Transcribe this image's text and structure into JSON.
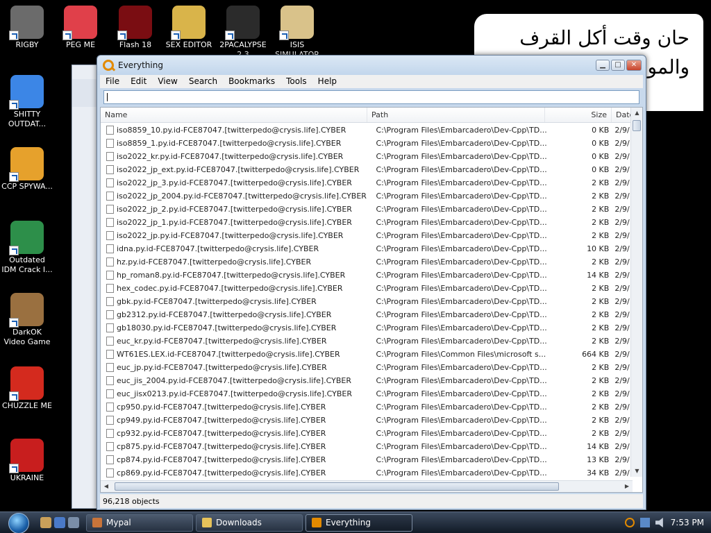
{
  "desktop_icons": [
    {
      "label": "RIGBY",
      "color": "#6b6b6b"
    },
    {
      "label": "PEG ME",
      "color": "#e0404a"
    },
    {
      "label": "Flash 18",
      "color": "#7a0d12"
    },
    {
      "label": "SEX EDITOR",
      "color": "#d9b44a"
    },
    {
      "label": "2PACALYPSE 2.3",
      "color": "#2b2b2b"
    },
    {
      "label": "ISIS SIMULATOR",
      "color": "#d9c28a"
    },
    {
      "label": "SHITTY OUTDAT...",
      "color": "#3c86e6"
    },
    {
      "label": "CCP SPYWA...",
      "color": "#e6a12c"
    },
    {
      "label": "Outdated IDM Crack I...",
      "color": "#2d8f4a"
    },
    {
      "label": "DarkOK Video Game",
      "color": "#9a7040"
    },
    {
      "label": "CHUZZLE ME",
      "color": "#d42a1e"
    },
    {
      "label": "UKRAINE",
      "color": "#c81e1e"
    }
  ],
  "meme": {
    "line1": "حان وقت أكل القرف",
    "line2": "والمو"
  },
  "window": {
    "title": "Everything",
    "menu": [
      "File",
      "Edit",
      "View",
      "Search",
      "Bookmarks",
      "Tools",
      "Help"
    ],
    "search_value": "",
    "columns": {
      "name": "Name",
      "path": "Path",
      "size": "Size",
      "date": "Date"
    },
    "rows": [
      {
        "name": "iso8859_10.py.id-FCE87047.[twitterpedo@crysis.life].CYBER",
        "path": "C:\\Program Files\\Embarcadero\\Dev-Cpp\\TD...",
        "size": "0 KB",
        "date": "2/9/"
      },
      {
        "name": "iso8859_1.py.id-FCE87047.[twitterpedo@crysis.life].CYBER",
        "path": "C:\\Program Files\\Embarcadero\\Dev-Cpp\\TD...",
        "size": "0 KB",
        "date": "2/9/"
      },
      {
        "name": "iso2022_kr.py.id-FCE87047.[twitterpedo@crysis.life].CYBER",
        "path": "C:\\Program Files\\Embarcadero\\Dev-Cpp\\TD...",
        "size": "0 KB",
        "date": "2/9/"
      },
      {
        "name": "iso2022_jp_ext.py.id-FCE87047.[twitterpedo@crysis.life].CYBER",
        "path": "C:\\Program Files\\Embarcadero\\Dev-Cpp\\TD...",
        "size": "0 KB",
        "date": "2/9/"
      },
      {
        "name": "iso2022_jp_3.py.id-FCE87047.[twitterpedo@crysis.life].CYBER",
        "path": "C:\\Program Files\\Embarcadero\\Dev-Cpp\\TD...",
        "size": "2 KB",
        "date": "2/9/"
      },
      {
        "name": "iso2022_jp_2004.py.id-FCE87047.[twitterpedo@crysis.life].CYBER",
        "path": "C:\\Program Files\\Embarcadero\\Dev-Cpp\\TD...",
        "size": "2 KB",
        "date": "2/9/"
      },
      {
        "name": "iso2022_jp_2.py.id-FCE87047.[twitterpedo@crysis.life].CYBER",
        "path": "C:\\Program Files\\Embarcadero\\Dev-Cpp\\TD...",
        "size": "2 KB",
        "date": "2/9/"
      },
      {
        "name": "iso2022_jp_1.py.id-FCE87047.[twitterpedo@crysis.life].CYBER",
        "path": "C:\\Program Files\\Embarcadero\\Dev-Cpp\\TD...",
        "size": "2 KB",
        "date": "2/9/"
      },
      {
        "name": "iso2022_jp.py.id-FCE87047.[twitterpedo@crysis.life].CYBER",
        "path": "C:\\Program Files\\Embarcadero\\Dev-Cpp\\TD...",
        "size": "2 KB",
        "date": "2/9/"
      },
      {
        "name": "idna.py.id-FCE87047.[twitterpedo@crysis.life].CYBER",
        "path": "C:\\Program Files\\Embarcadero\\Dev-Cpp\\TD...",
        "size": "10 KB",
        "date": "2/9/"
      },
      {
        "name": "hz.py.id-FCE87047.[twitterpedo@crysis.life].CYBER",
        "path": "C:\\Program Files\\Embarcadero\\Dev-Cpp\\TD...",
        "size": "2 KB",
        "date": "2/9/"
      },
      {
        "name": "hp_roman8.py.id-FCE87047.[twitterpedo@crysis.life].CYBER",
        "path": "C:\\Program Files\\Embarcadero\\Dev-Cpp\\TD...",
        "size": "14 KB",
        "date": "2/9/"
      },
      {
        "name": "hex_codec.py.id-FCE87047.[twitterpedo@crysis.life].CYBER",
        "path": "C:\\Program Files\\Embarcadero\\Dev-Cpp\\TD...",
        "size": "2 KB",
        "date": "2/9/"
      },
      {
        "name": "gbk.py.id-FCE87047.[twitterpedo@crysis.life].CYBER",
        "path": "C:\\Program Files\\Embarcadero\\Dev-Cpp\\TD...",
        "size": "2 KB",
        "date": "2/9/"
      },
      {
        "name": "gb2312.py.id-FCE87047.[twitterpedo@crysis.life].CYBER",
        "path": "C:\\Program Files\\Embarcadero\\Dev-Cpp\\TD...",
        "size": "2 KB",
        "date": "2/9/"
      },
      {
        "name": "gb18030.py.id-FCE87047.[twitterpedo@crysis.life].CYBER",
        "path": "C:\\Program Files\\Embarcadero\\Dev-Cpp\\TD...",
        "size": "2 KB",
        "date": "2/9/"
      },
      {
        "name": "euc_kr.py.id-FCE87047.[twitterpedo@crysis.life].CYBER",
        "path": "C:\\Program Files\\Embarcadero\\Dev-Cpp\\TD...",
        "size": "2 KB",
        "date": "2/9/"
      },
      {
        "name": "WT61ES.LEX.id-FCE87047.[twitterpedo@crysis.life].CYBER",
        "path": "C:\\Program Files\\Common Files\\microsoft s...",
        "size": "664 KB",
        "date": "2/9/"
      },
      {
        "name": "euc_jp.py.id-FCE87047.[twitterpedo@crysis.life].CYBER",
        "path": "C:\\Program Files\\Embarcadero\\Dev-Cpp\\TD...",
        "size": "2 KB",
        "date": "2/9/"
      },
      {
        "name": "euc_jis_2004.py.id-FCE87047.[twitterpedo@crysis.life].CYBER",
        "path": "C:\\Program Files\\Embarcadero\\Dev-Cpp\\TD...",
        "size": "2 KB",
        "date": "2/9/"
      },
      {
        "name": "euc_jisx0213.py.id-FCE87047.[twitterpedo@crysis.life].CYBER",
        "path": "C:\\Program Files\\Embarcadero\\Dev-Cpp\\TD...",
        "size": "2 KB",
        "date": "2/9/"
      },
      {
        "name": "cp950.py.id-FCE87047.[twitterpedo@crysis.life].CYBER",
        "path": "C:\\Program Files\\Embarcadero\\Dev-Cpp\\TD...",
        "size": "2 KB",
        "date": "2/9/"
      },
      {
        "name": "cp949.py.id-FCE87047.[twitterpedo@crysis.life].CYBER",
        "path": "C:\\Program Files\\Embarcadero\\Dev-Cpp\\TD...",
        "size": "2 KB",
        "date": "2/9/"
      },
      {
        "name": "cp932.py.id-FCE87047.[twitterpedo@crysis.life].CYBER",
        "path": "C:\\Program Files\\Embarcadero\\Dev-Cpp\\TD...",
        "size": "2 KB",
        "date": "2/9/"
      },
      {
        "name": "cp875.py.id-FCE87047.[twitterpedo@crysis.life].CYBER",
        "path": "C:\\Program Files\\Embarcadero\\Dev-Cpp\\TD...",
        "size": "14 KB",
        "date": "2/9/"
      },
      {
        "name": "cp874.py.id-FCE87047.[twitterpedo@crysis.life].CYBER",
        "path": "C:\\Program Files\\Embarcadero\\Dev-Cpp\\TD...",
        "size": "13 KB",
        "date": "2/9/"
      },
      {
        "name": "cp869.py.id-FCE87047.[twitterpedo@crysis.life].CYBER",
        "path": "C:\\Program Files\\Embarcadero\\Dev-Cpp\\TD...",
        "size": "34 KB",
        "date": "2/9/"
      }
    ],
    "status": "96,218 objects"
  },
  "taskbar": {
    "buttons": [
      {
        "label": "Mypal",
        "color": "#c8743a"
      },
      {
        "label": "Downloads",
        "color": "#e6c25a"
      },
      {
        "label": "Everything",
        "color": "#e38a00"
      }
    ],
    "clock": "7:53 PM"
  }
}
